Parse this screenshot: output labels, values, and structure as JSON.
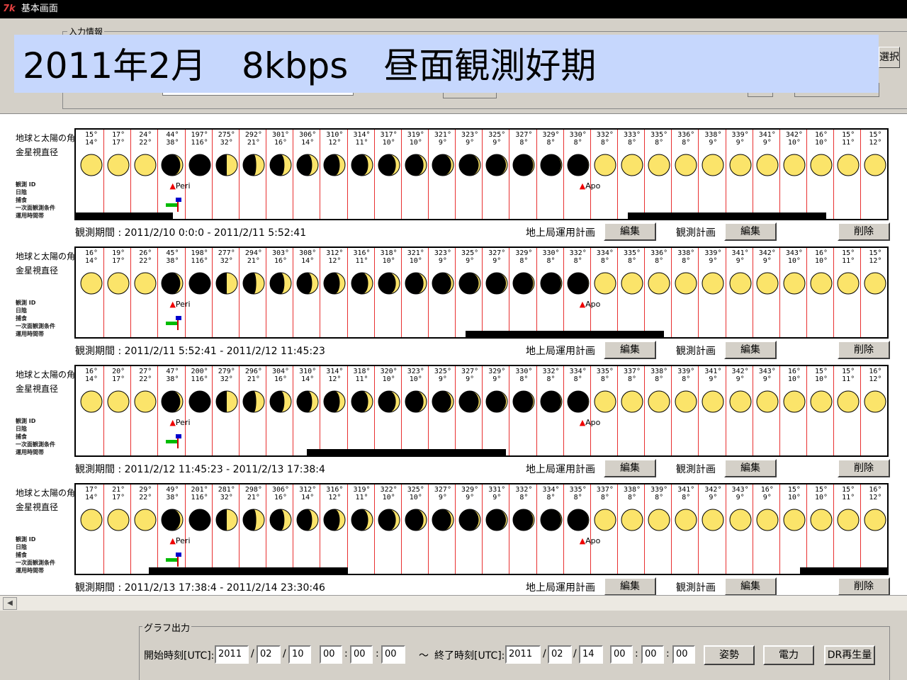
{
  "window": {
    "logo": "7k",
    "title": "基本画面"
  },
  "input_section": {
    "legend": "入力情報",
    "select_button": "選択"
  },
  "banner": {
    "text": "2011年2月　8kbps　昼面観測好期"
  },
  "sidebar": {
    "line1": "地球と太陽の角",
    "line2": "金星視直径",
    "small_labels": [
      "観測 ID",
      "日陰",
      "捕食",
      "一次面観測条件",
      "運用時間帯"
    ]
  },
  "markers": {
    "peri": "Peri",
    "apo": "Apo"
  },
  "buttons": {
    "ground_plan": "地上局運用計画",
    "edit": "編集",
    "obs_plan": "観測計画",
    "delete": "削除"
  },
  "colors": {
    "moon": "#fbe46a",
    "grid_line": "#e83030",
    "banner": "#c6d7fd"
  },
  "panels": [
    {
      "period": "観測期間 : 2011/2/10 0:0:0 - 2011/2/11 5:52:41",
      "angles": [
        [
          "15°",
          "14°"
        ],
        [
          "17°",
          "17°"
        ],
        [
          "24°",
          "22°"
        ],
        [
          "44°",
          "38°"
        ],
        [
          "197°",
          "116°"
        ],
        [
          "275°",
          "32°"
        ],
        [
          "292°",
          "21°"
        ],
        [
          "301°",
          "16°"
        ],
        [
          "306°",
          "14°"
        ],
        [
          "310°",
          "12°"
        ],
        [
          "314°",
          "11°"
        ],
        [
          "317°",
          "10°"
        ],
        [
          "319°",
          "10°"
        ],
        [
          "321°",
          "9°"
        ],
        [
          "323°",
          "9°"
        ],
        [
          "325°",
          "9°"
        ],
        [
          "327°",
          "8°"
        ],
        [
          "329°",
          "8°"
        ],
        [
          "330°",
          "8°"
        ],
        [
          "332°",
          "8°"
        ],
        [
          "333°",
          "8°"
        ],
        [
          "335°",
          "8°"
        ],
        [
          "336°",
          "8°"
        ],
        [
          "338°",
          "9°"
        ],
        [
          "339°",
          "9°"
        ],
        [
          "341°",
          "9°"
        ],
        [
          "342°",
          "10°"
        ],
        [
          "16°",
          "10°"
        ],
        [
          "15°",
          "11°"
        ],
        [
          "15°",
          "12°"
        ]
      ],
      "bars": [
        [
          0,
          0.12
        ],
        [
          0.68,
          0.925
        ]
      ]
    },
    {
      "period": "観測期間 : 2011/2/11 5:52:41 - 2011/2/12 11:45:23",
      "angles": [
        [
          "16°",
          "14°"
        ],
        [
          "19°",
          "17°"
        ],
        [
          "26°",
          "22°"
        ],
        [
          "45°",
          "38°"
        ],
        [
          "198°",
          "116°"
        ],
        [
          "277°",
          "32°"
        ],
        [
          "294°",
          "21°"
        ],
        [
          "303°",
          "16°"
        ],
        [
          "308°",
          "14°"
        ],
        [
          "312°",
          "12°"
        ],
        [
          "316°",
          "11°"
        ],
        [
          "318°",
          "10°"
        ],
        [
          "321°",
          "10°"
        ],
        [
          "323°",
          "9°"
        ],
        [
          "325°",
          "9°"
        ],
        [
          "327°",
          "9°"
        ],
        [
          "329°",
          "8°"
        ],
        [
          "330°",
          "8°"
        ],
        [
          "332°",
          "8°"
        ],
        [
          "334°",
          "8°"
        ],
        [
          "335°",
          "8°"
        ],
        [
          "336°",
          "8°"
        ],
        [
          "338°",
          "8°"
        ],
        [
          "339°",
          "9°"
        ],
        [
          "341°",
          "9°"
        ],
        [
          "342°",
          "9°"
        ],
        [
          "343°",
          "10°"
        ],
        [
          "16°",
          "10°"
        ],
        [
          "15°",
          "11°"
        ],
        [
          "15°",
          "12°"
        ]
      ],
      "bars": [
        [
          0.48,
          0.725
        ]
      ]
    },
    {
      "period": "観測期間 : 2011/2/12 11:45:23 - 2011/2/13 17:38:4",
      "angles": [
        [
          "16°",
          "14°"
        ],
        [
          "20°",
          "17°"
        ],
        [
          "27°",
          "22°"
        ],
        [
          "47°",
          "38°"
        ],
        [
          "200°",
          "116°"
        ],
        [
          "279°",
          "32°"
        ],
        [
          "296°",
          "21°"
        ],
        [
          "304°",
          "16°"
        ],
        [
          "310°",
          "14°"
        ],
        [
          "314°",
          "12°"
        ],
        [
          "318°",
          "11°"
        ],
        [
          "320°",
          "10°"
        ],
        [
          "323°",
          "10°"
        ],
        [
          "325°",
          "9°"
        ],
        [
          "327°",
          "9°"
        ],
        [
          "329°",
          "9°"
        ],
        [
          "330°",
          "8°"
        ],
        [
          "332°",
          "8°"
        ],
        [
          "334°",
          "8°"
        ],
        [
          "335°",
          "8°"
        ],
        [
          "337°",
          "8°"
        ],
        [
          "338°",
          "8°"
        ],
        [
          "339°",
          "8°"
        ],
        [
          "341°",
          "9°"
        ],
        [
          "342°",
          "9°"
        ],
        [
          "343°",
          "9°"
        ],
        [
          "16°",
          "10°"
        ],
        [
          "15°",
          "10°"
        ],
        [
          "15°",
          "11°"
        ],
        [
          "16°",
          "12°"
        ]
      ],
      "bars": [
        [
          0.285,
          0.53
        ]
      ]
    },
    {
      "period": "観測期間 : 2011/2/13 17:38:4 - 2011/2/14 23:30:46",
      "angles": [
        [
          "17°",
          "14°"
        ],
        [
          "21°",
          "17°"
        ],
        [
          "29°",
          "22°"
        ],
        [
          "49°",
          "38°"
        ],
        [
          "201°",
          "116°"
        ],
        [
          "281°",
          "32°"
        ],
        [
          "298°",
          "21°"
        ],
        [
          "306°",
          "16°"
        ],
        [
          "312°",
          "14°"
        ],
        [
          "316°",
          "12°"
        ],
        [
          "319°",
          "11°"
        ],
        [
          "322°",
          "10°"
        ],
        [
          "325°",
          "10°"
        ],
        [
          "327°",
          "9°"
        ],
        [
          "329°",
          "9°"
        ],
        [
          "331°",
          "9°"
        ],
        [
          "332°",
          "8°"
        ],
        [
          "334°",
          "8°"
        ],
        [
          "335°",
          "8°"
        ],
        [
          "337°",
          "8°"
        ],
        [
          "338°",
          "8°"
        ],
        [
          "339°",
          "8°"
        ],
        [
          "341°",
          "8°"
        ],
        [
          "342°",
          "9°"
        ],
        [
          "343°",
          "9°"
        ],
        [
          "16°",
          "9°"
        ],
        [
          "15°",
          "10°"
        ],
        [
          "15°",
          "10°"
        ],
        [
          "15°",
          "11°"
        ],
        [
          "16°",
          "12°"
        ]
      ],
      "bars": [
        [
          0.09,
          0.335
        ],
        [
          0.893,
          1.0
        ]
      ]
    }
  ],
  "graph_output": {
    "legend": "グラフ出力",
    "start_label": "開始時刻[UTC]:",
    "end_label": "終了時刻[UTC]:",
    "tilde": "～",
    "start": {
      "year": "2011",
      "month": "02",
      "day": "10",
      "hour": "00",
      "min": "00",
      "sec": "00"
    },
    "end": {
      "year": "2011",
      "month": "02",
      "day": "14",
      "hour": "00",
      "min": "00",
      "sec": "00"
    },
    "buttons": {
      "attitude": "姿勢",
      "power": "電力",
      "dr": "DR再生量"
    }
  }
}
